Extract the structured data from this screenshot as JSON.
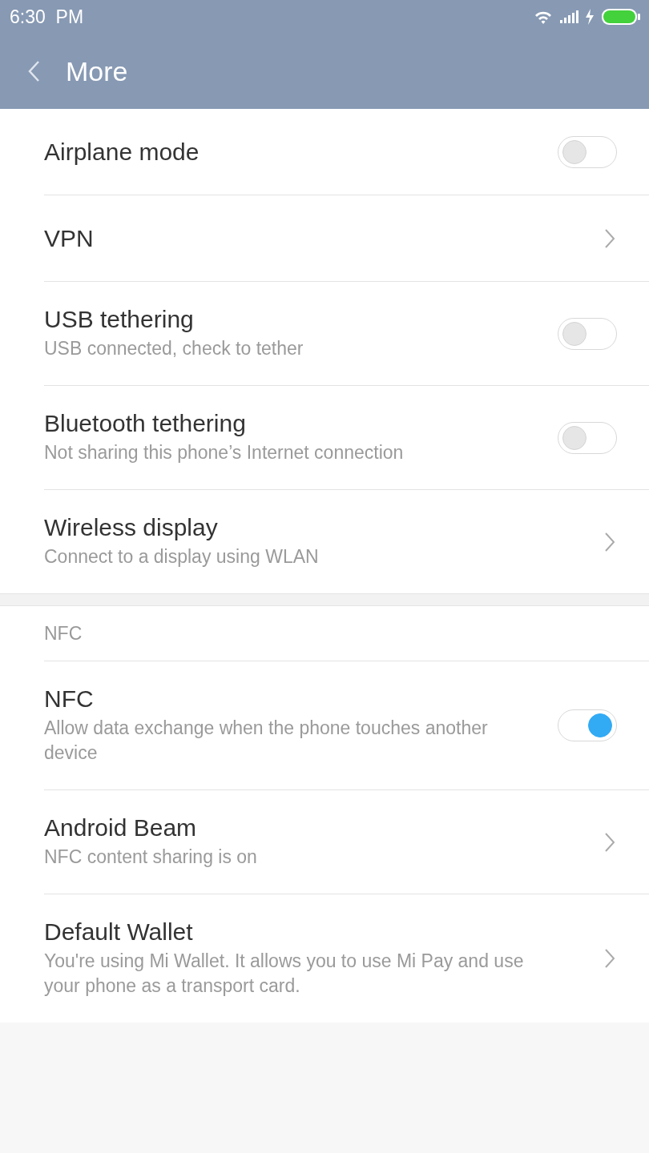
{
  "status_bar": {
    "time": "6:30  PM"
  },
  "header": {
    "title": "More"
  },
  "sections": [
    {
      "items": [
        {
          "kind": "toggle",
          "title": "Airplane mode",
          "on": false
        },
        {
          "kind": "link",
          "title": "VPN"
        },
        {
          "kind": "toggle",
          "title": "USB tethering",
          "subtitle": "USB connected, check to tether",
          "on": false
        },
        {
          "kind": "toggle",
          "title": "Bluetooth tethering",
          "subtitle": "Not sharing this phone’s Internet connection",
          "on": false
        },
        {
          "kind": "link",
          "title": "Wireless display",
          "subtitle": "Connect to a display using WLAN"
        }
      ]
    },
    {
      "header": "NFC",
      "items": [
        {
          "kind": "toggle",
          "title": "NFC",
          "subtitle": "Allow data exchange when the phone touches another device",
          "on": true
        },
        {
          "kind": "link",
          "title": "Android Beam",
          "subtitle": "NFC content sharing is on"
        },
        {
          "kind": "link",
          "title": "Default Wallet",
          "subtitle": "You're using Mi Wallet. It allows you to use Mi Pay and use your phone as a transport card."
        }
      ]
    }
  ]
}
